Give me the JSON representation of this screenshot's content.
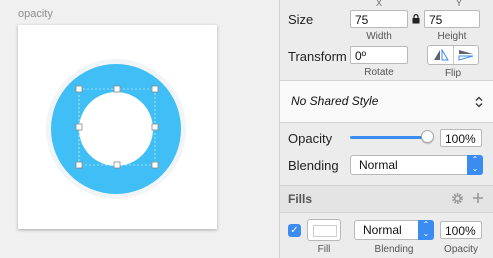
{
  "canvas": {
    "artboard_label": "opacity",
    "shape_color": "#3fbff5"
  },
  "inspector": {
    "size": {
      "label": "Size",
      "width_value": "75",
      "height_value": "75",
      "width_label": "Width",
      "height_label": "Height",
      "x_label": "X",
      "y_label": "Y"
    },
    "transform": {
      "label": "Transform",
      "rotate_value": "0º",
      "rotate_label": "Rotate",
      "flip_label": "Flip"
    },
    "shared_style": {
      "value": "No Shared Style"
    },
    "opacity": {
      "label": "Opacity",
      "value": "100%",
      "level": 1.0
    },
    "blending": {
      "label": "Blending",
      "value": "Normal"
    },
    "fills": {
      "title": "Fills",
      "blend_value": "Normal",
      "opacity_value": "100%",
      "fill_label": "Fill",
      "blending_label": "Blending",
      "opacity_label": "Opacity",
      "enabled": true,
      "swatch_color": "#ffffff"
    },
    "accent_color": "#3b8cf0"
  }
}
